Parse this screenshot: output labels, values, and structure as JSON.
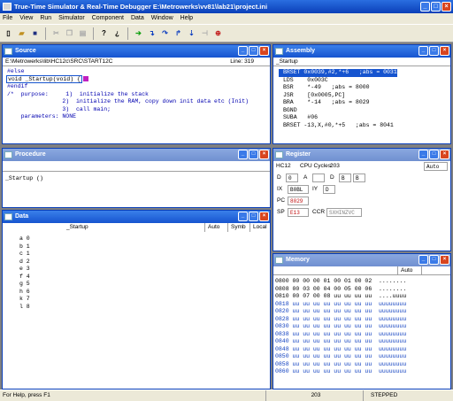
{
  "title": "True-Time Simulator & Real-Time Debugger   E:\\Metrowerks\\vv81\\lab21\\project.ini",
  "menu": [
    "File",
    "View",
    "Run",
    "Simulator",
    "Component",
    "Data",
    "Window",
    "Help"
  ],
  "source": {
    "title": "Source",
    "path": "E:\\Metrowerks\\lib\\HC12c\\SRC\\START12C",
    "line": "Line: 319",
    "code": [
      "#else",
      "void _Startup(void) {",
      "#endif",
      "/*  purpose:     1)  initialize the stack",
      "                2)  initialize the RAM, copy down init data etc (Init)",
      "                3)  call main;",
      "    parameters: NONE"
    ]
  },
  "assembly": {
    "title": "Assembly",
    "header": "_Startup",
    "lines": [
      "BRSET 0x0039,#2,*+6   ;abs = 0031",
      "LDS    0x003C",
      "BSR    *-49   ;abs = 8000",
      "JSR    [0x0005,PC]",
      "BRA    *-14   ;abs = 8029",
      "BGND",
      "SUBA   #06",
      "BRSET -13,X,#0,*+5   ;abs = 8041"
    ]
  },
  "procedure": {
    "title": "Procedure",
    "item": "_Startup ()"
  },
  "register": {
    "title": "Register",
    "cpu": "HC12",
    "cycles_label": "CPU Cycles:",
    "cycles": "203",
    "mode": "Auto",
    "d": "D",
    "d_val": "0",
    "a": "A",
    "a_val": "0",
    "dd": "D",
    "b": "B",
    "b_val": "0",
    "ix": "IX",
    "ix_val": "B0BL",
    "iy": "IY",
    "iy_val": "D",
    "pc": "PC",
    "pc_val": "8029",
    "sp": "SP",
    "sp_val": "E13",
    "ccr": "CCR",
    "ccr_val": "SXHINZVC"
  },
  "data": {
    "title": "Data",
    "header": "_Startup",
    "col_auto": "Auto",
    "col_symb": "Symb",
    "col_local": "Local",
    "vars": [
      "a 0",
      "b 1",
      "c 1",
      "d 2",
      "e 3",
      "f 4",
      "g 5",
      "h 6",
      "k 7",
      "l 8"
    ]
  },
  "memory": {
    "title": "Memory",
    "mode": "Auto",
    "rows": [
      "0800 00 00 00 01 00 01 00 02  ........",
      "0808 00 03 00 04 00 05 00 06  ........",
      "0810 00 07 00 08 uu uu uu uu  ....uuuu",
      "0818 uu uu uu uu uu uu uu uu  uuuuuuuu",
      "0820 uu uu uu uu uu uu uu uu  uuuuuuuu",
      "0828 uu uu uu uu uu uu uu uu  uuuuuuuu",
      "0830 uu uu uu uu uu uu uu uu  uuuuuuuu",
      "0838 uu uu uu uu uu uu uu uu  uuuuuuuu",
      "0840 uu uu uu uu uu uu uu uu  uuuuuuuu",
      "0848 uu uu uu uu uu uu uu uu  uuuuuuuu",
      "0850 uu uu uu uu uu uu uu uu  uuuuuuuu",
      "0858 uu uu uu uu uu uu uu uu  uuuuuuuu",
      "0860 uu uu uu uu uu uu uu uu  uuuuuuuu"
    ]
  },
  "status": {
    "help": "For Help, press F1",
    "cycles": "203",
    "state": "STEPPED"
  }
}
